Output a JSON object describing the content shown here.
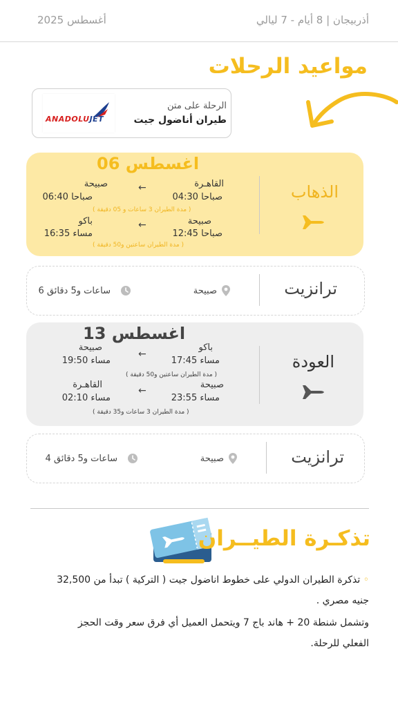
{
  "header": {
    "trip_info": "أذربيجان | 8 أيام - 7 ليالي",
    "month_year": "أغسطس 2025"
  },
  "schedule": {
    "title": "مواعيد الرحلات",
    "airline_on": "الرحلة على متن",
    "airline_name": "طيران أناضول جيت",
    "logo_text_a": "ANADOLU",
    "logo_text_b": "JET"
  },
  "outbound": {
    "label": "الذهاب",
    "date": "06 اغسطس",
    "leg1": {
      "from_city": "القاهـرة",
      "from_time": "04:30 صباحا",
      "to_city": "صبيحة",
      "to_time": "06:40 صباحا",
      "duration": "( مدة الطيران 3 ساعات  و 05 دقيقة )"
    },
    "leg2": {
      "from_city": "صبيحة",
      "from_time": "12:45 صباحا",
      "to_city": "باكو",
      "to_time": "16:35 مساء",
      "duration": "( مدة الطيران ساعتين  و50 دقيقة )"
    }
  },
  "transit1": {
    "label": "ترانزيت",
    "city": "صبيحة",
    "duration": "6 ساعات و5 دقائق"
  },
  "return": {
    "label": "العودة",
    "date": "13 اغسطس",
    "leg1": {
      "from_city": "باكو",
      "from_time": "17:45 مساء",
      "to_city": "صبيحة",
      "to_time": "19:50 مساء",
      "duration": "( مدة الطيران ساعتين  و50 دقيقة )"
    },
    "leg2": {
      "from_city": "صبيحة",
      "from_time": "23:55 مساء",
      "to_city": "القاهـرة",
      "to_time": "02:10 مساء",
      "duration": "( مدة الطيران 3 ساعات و35 دقيقة )"
    }
  },
  "transit2": {
    "label": "ترانزيت",
    "city": "صبيحة",
    "duration": "4 ساعات و5 دقائق"
  },
  "ticket": {
    "title": "تذكـرة الطيــران",
    "line1": "تذكرة الطيران الدولي على خطوط اناضول جيت ( التركية ) تبدأ من 32,500",
    "line2": "جنيه مصري .",
    "line3": "وتشمل  شنطة 20 + هاند باج 7 ويتحمل العميل أي فرق سعر وقت الحجز",
    "line4": "الفعلي للرحلة."
  },
  "colors": {
    "accent": "#f5bd1f",
    "outbound_bg": "#fde9a5",
    "return_bg": "#eeeeee"
  },
  "icons": [
    "hand-drawn-arrow-icon",
    "airline-logo",
    "airplane-icon",
    "location-pin-icon",
    "clock-icon",
    "ticket-icon",
    "left-arrow-icon"
  ]
}
